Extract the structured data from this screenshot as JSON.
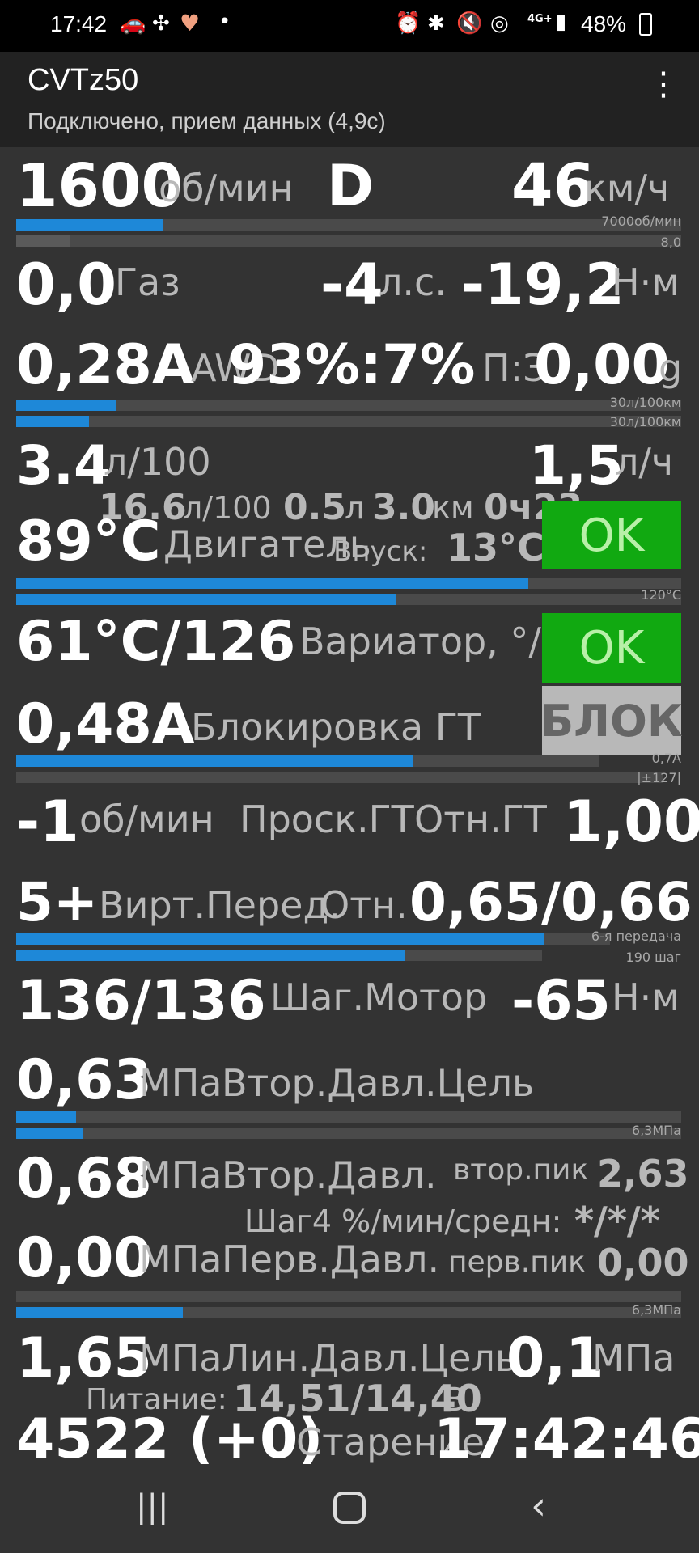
{
  "status": {
    "time": "17:42",
    "signal_text": "4G+",
    "battery": "48%",
    "dot": "•"
  },
  "app": {
    "title": "CVTz50",
    "subtitle": "Подключено, прием данных (4,9с)"
  },
  "rows": {
    "rpm_val": "1600",
    "rpm_unit": "об/мин",
    "gear": "D",
    "speed_val": "46",
    "speed_unit": "км/ч",
    "rpm_max": "7000об/мин",
    "bar2_max": "8,0",
    "throttle_val": "0,0",
    "throttle_label": "Газ",
    "hp_val": "-4",
    "hp_unit": "л.с.",
    "torque_val": "-19,2",
    "torque_unit": "Н·м",
    "awd_val": "0,28A",
    "awd_label": "AWD",
    "awd_ratio": "93%:7%",
    "g_label": "П:З",
    "g_val": "0,00",
    "g_unit": "g",
    "fuel_max1": "30л/100км",
    "fuel_max2": "30л/100км",
    "fuel_inst": "3.4",
    "fuel_inst_unit": "л/100",
    "fuel_hour": "1,5",
    "fuel_hour_unit": "л/ч",
    "trip_avg": "16.6",
    "trip_avg_unit": "л/100",
    "trip_fuel": "0.5",
    "trip_fuel_unit": "л",
    "trip_dist": "3.0",
    "trip_dist_unit": "км",
    "trip_time": "0ч23",
    "eng_temp": "89°C",
    "eng_label": "Двигатель",
    "intake_label": "Впуск:",
    "intake_val": "13°C",
    "eng_status": "OK",
    "temp_max": "120°C",
    "cvt_temp": "61°C/126",
    "cvt_label": "Вариатор, °/...",
    "cvt_status": "OK",
    "lock_val": "0,48A",
    "lock_label": "Блокировка ГТ",
    "lock_status": "БЛОК",
    "lock_max": "0,7A",
    "lock_max2": "|±127|",
    "slip_val": "-1",
    "slip_unit": "об/мин",
    "slip_label": "Проск.ГТ",
    "tc_ratio_label": "Отн.ГТ",
    "tc_ratio_val": "1,00",
    "vgear_val": "5+",
    "vgear_label": "Вирт.Перед.",
    "gear_ratio_label": "Отн.",
    "gear_ratio_val": "0,65/0,66",
    "gear_max": "6-я передача",
    "step_max": "190 шаг",
    "step_val": "136/136",
    "step_label": "Шаг.Мотор",
    "step_torque": "-65",
    "step_torque_unit": "Н·м",
    "sec_target": "0,63",
    "sec_target_unit": "МПа",
    "sec_target_label": "Втор.Давл.Цель",
    "press_max1": "6,3МПа",
    "sec_val": "0,68",
    "sec_unit": "МПа",
    "sec_label": "Втор.Давл.",
    "sec_peak_label": "втор.пик",
    "sec_peak": "2,63",
    "step4_label": "Шаг4 %/мин/средн:",
    "step4_val": "*/*/*",
    "pri_val": "0,00",
    "pri_unit": "МПа",
    "pri_label": "Перв.Давл.",
    "pri_peak_label": "перв.пик",
    "pri_peak": "0,00",
    "press_max2": "6,3МПа",
    "line_val": "1,65",
    "line_unit": "МПа",
    "line_label": "Лин.Давл.Цель",
    "line_target": "0,1",
    "line_target_unit": "МПа",
    "power_label": "Питание:",
    "power_val": "14,51/14,40",
    "power_unit": "В",
    "age_val": "4522 (+0)",
    "age_label": "Старение",
    "clock": "17:42:46"
  },
  "bars": {
    "rpm": 0.22,
    "bar2": 0.08,
    "fuel1": 0.15,
    "fuel2": 0.11,
    "temp1": 0.77,
    "temp2": 0.57,
    "lock1": 0.68,
    "lock2": 0.0,
    "gear1": 0.89,
    "gear2": 0.74,
    "press1": 0.09,
    "press2": 0.1,
    "press3": 0.0,
    "press4": 0.25
  },
  "icons": [
    "car-icon",
    "fan-icon",
    "heart-icon",
    "alarm-icon",
    "bluetooth-icon",
    "mute-icon",
    "hotspot-icon",
    "signal-icon",
    "battery-icon",
    "more-vert-icon",
    "recents-icon",
    "home-icon",
    "back-icon"
  ]
}
